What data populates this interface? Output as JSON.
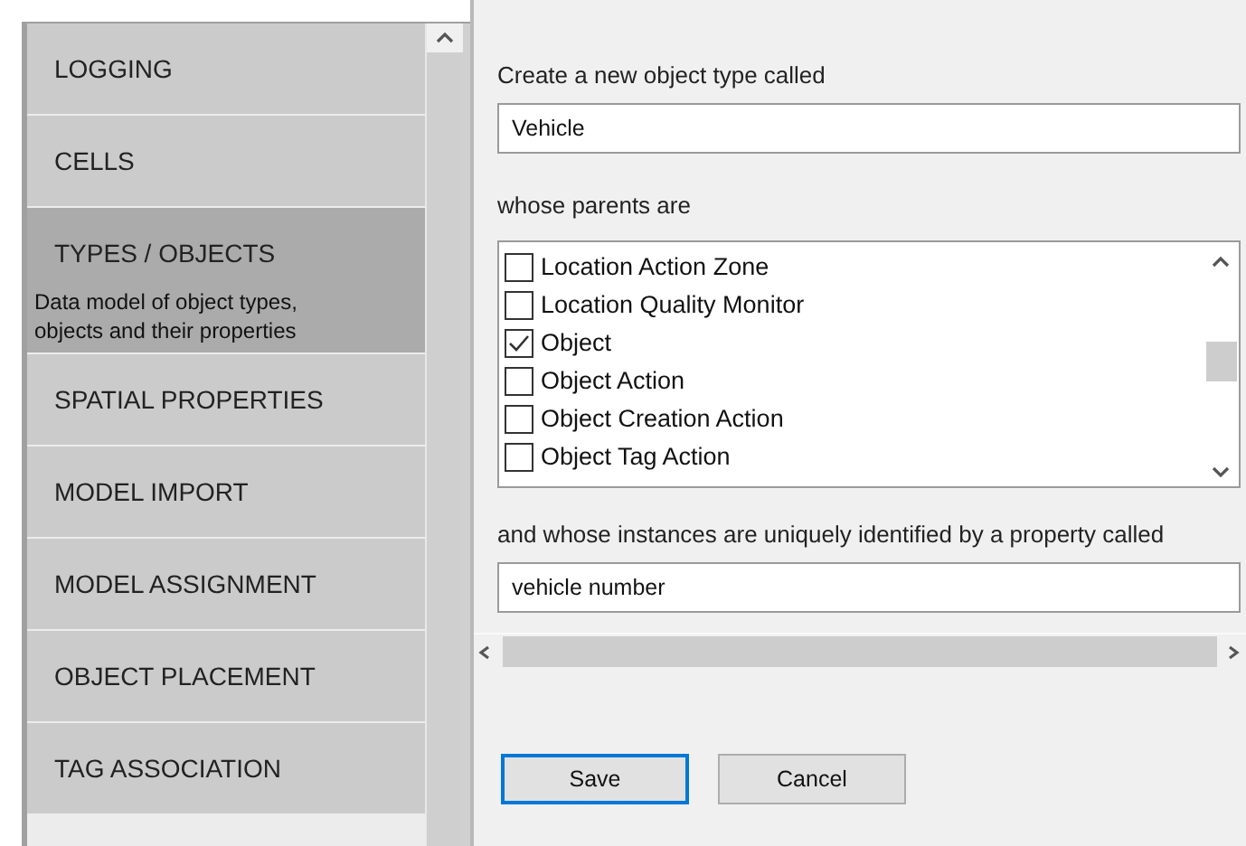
{
  "sidebar": {
    "items": [
      {
        "label": "LOGGING",
        "selected": false
      },
      {
        "label": "CELLS",
        "selected": false
      },
      {
        "label": "TYPES / OBJECTS",
        "selected": true,
        "description": "Data model of object types, objects and their properties"
      },
      {
        "label": "SPATIAL PROPERTIES",
        "selected": false
      },
      {
        "label": "MODEL IMPORT",
        "selected": false
      },
      {
        "label": "MODEL ASSIGNMENT",
        "selected": false
      },
      {
        "label": "OBJECT PLACEMENT",
        "selected": false
      },
      {
        "label": "TAG ASSOCIATION",
        "selected": false
      }
    ]
  },
  "form": {
    "name_label": "Create a new object type called",
    "name_value": "Vehicle",
    "parents_label": "whose parents are",
    "parents": [
      {
        "label": "Location Action Zone",
        "checked": false
      },
      {
        "label": "Location Quality Monitor",
        "checked": false
      },
      {
        "label": "Object",
        "checked": true
      },
      {
        "label": "Object Action",
        "checked": false
      },
      {
        "label": "Object Creation Action",
        "checked": false
      },
      {
        "label": "Object Tag Action",
        "checked": false
      }
    ],
    "id_label": "and whose instances are uniquely identified by a property called",
    "id_value": "vehicle number"
  },
  "buttons": [
    {
      "label": "Save",
      "focused": true
    },
    {
      "label": "Cancel",
      "focused": false
    }
  ]
}
